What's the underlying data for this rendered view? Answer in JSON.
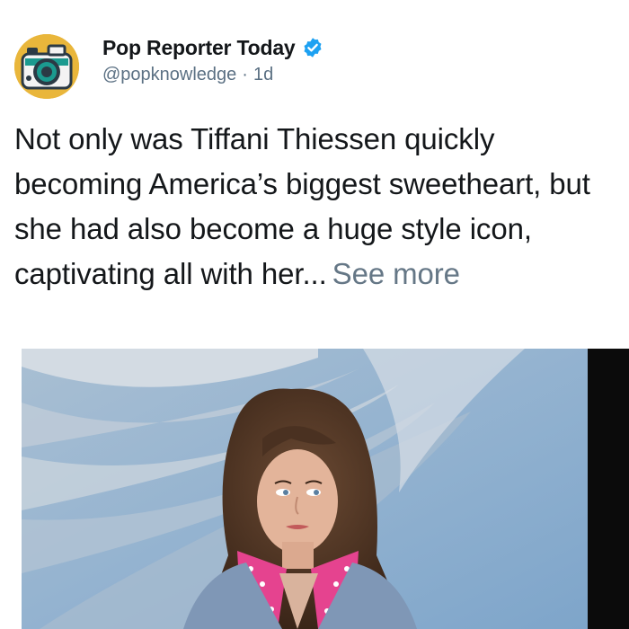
{
  "account": {
    "display_name": "Pop Reporter Today",
    "handle": "@popknowledge",
    "separator": "·",
    "age": "1d",
    "avatar_icon": "camera-icon",
    "verified_icon": "verified-badge-icon"
  },
  "post": {
    "text": "Not only was Tiffani Thiessen quickly becoming America’s biggest sweetheart, but she had also become a huge style icon, captivating all with her...",
    "see_more": "See more"
  },
  "colors": {
    "name": "#14171a",
    "meta": "#5b7083",
    "verified": "#1da1f2",
    "avatar_bg": "#e9b63b"
  }
}
